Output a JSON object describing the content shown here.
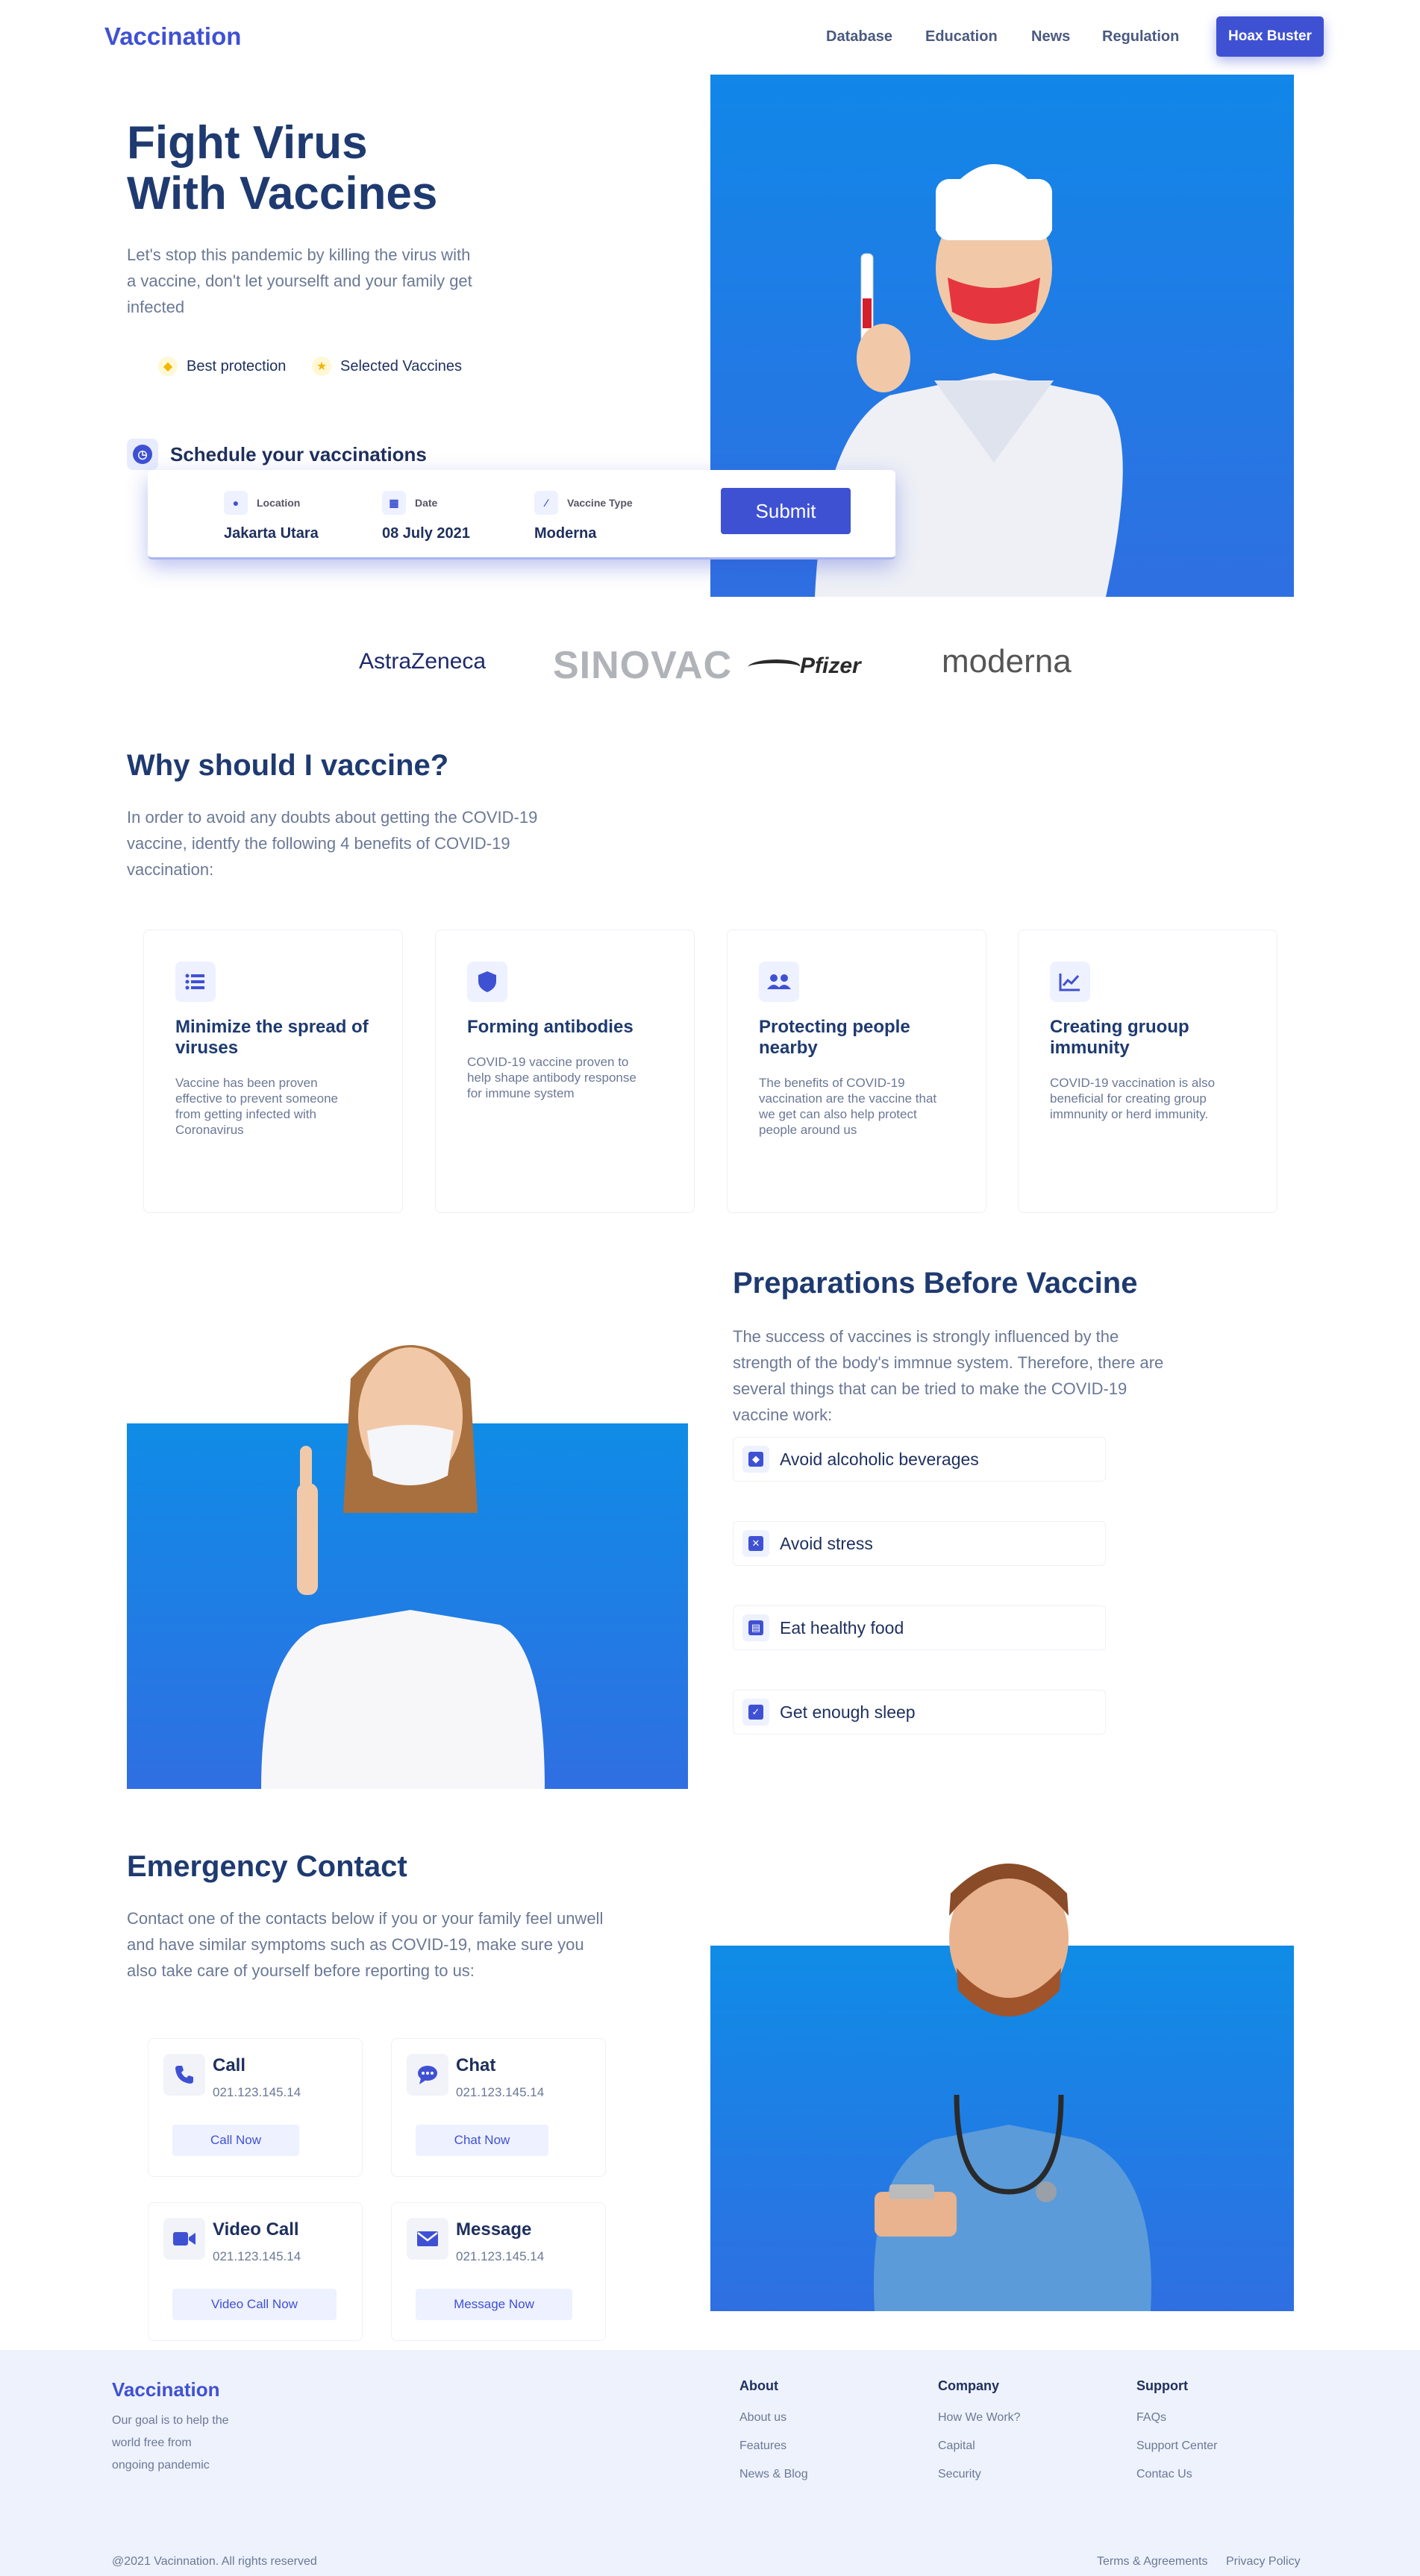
{
  "nav": {
    "logo": "Vaccination",
    "links": [
      "Database",
      "Education",
      "News",
      "Regulation"
    ],
    "cta": "Hoax Buster"
  },
  "hero": {
    "title_line1": "Fight Virus",
    "title_line2": "With Vaccines",
    "subtitle": "Let's stop this pandemic by killing the virus with a vaccine, don't let yourselft and your family get infected",
    "features": [
      "Best protection",
      "Selected Vaccines"
    ],
    "schedule_label": "Schedule your vaccinations",
    "form": {
      "location_label": "Location",
      "location_value": "Jakarta Utara",
      "date_label": "Date",
      "date_value": "08 July 2021",
      "vaccine_label": "Vaccine Type",
      "vaccine_value": "Moderna",
      "submit": "Submit"
    }
  },
  "partners": [
    "AstraZeneca",
    "SINOVAC",
    "Pfizer",
    "moderna"
  ],
  "why": {
    "title": "Why should I vaccine?",
    "text": "In order to avoid any doubts about getting the COVID-19 vaccine, identfy the following 4 benefits of COVID-19 vaccination:",
    "cards": [
      {
        "icon": "list-icon",
        "title": "Minimize the spread of viruses",
        "desc": "Vaccine has been proven effective to prevent someone from getting infected with Coronavirus"
      },
      {
        "icon": "shield-icon",
        "title": "Forming antibodies",
        "desc": "COVID-19 vaccine proven to help shape antibody response for immune system"
      },
      {
        "icon": "people-icon",
        "title": "Protecting people nearby",
        "desc": "The benefits of COVID-19 vaccination are the vaccine that we get can also help protect people around us"
      },
      {
        "icon": "chart-line-icon",
        "title": "Creating gruoup immunity",
        "desc": "COVID-19 vaccination is also beneficial for creating group immnunity or herd immunity."
      }
    ]
  },
  "prep": {
    "title": "Preparations Before Vaccine",
    "text": "The success of vaccines is strongly influenced by the strength of the body's immnue system. Therefore, there are several things that can be tried to make the COVID-19 vaccine work:",
    "items": [
      "Avoid alcoholic beverages",
      "Avoid stress",
      "Eat healthy food",
      "Get enough sleep"
    ]
  },
  "emergency": {
    "title": "Emergency Contact",
    "text": "Contact one of the contacts below if you or your family feel unwell and have similar symptoms such as COVID-19, make sure you also take care of yourself before reporting to us:",
    "contacts": [
      {
        "icon": "phone-icon",
        "title": "Call",
        "number": "021.123.145.14",
        "button": "Call Now"
      },
      {
        "icon": "chat-icon",
        "title": "Chat",
        "number": "021.123.145.14",
        "button": "Chat Now"
      },
      {
        "icon": "video-icon",
        "title": "Video Call",
        "number": "021.123.145.14",
        "button": "Video Call Now"
      },
      {
        "icon": "mail-icon",
        "title": "Message",
        "number": "021.123.145.14",
        "button": "Message Now"
      }
    ]
  },
  "footer": {
    "logo": "Vaccination",
    "goal": "Our goal is to help the world free from ongoing pandemic",
    "columns": [
      {
        "title": "About",
        "links": [
          "About us",
          "Features",
          "News & Blog"
        ]
      },
      {
        "title": "Company",
        "links": [
          "How We Work?",
          "Capital",
          "Security"
        ]
      },
      {
        "title": "Support",
        "links": [
          "FAQs",
          "Support Center",
          "Contac Us"
        ]
      }
    ],
    "copyright": "@2021 Vacinnation. All rights reserved",
    "terms": "Terms & Agreements",
    "privacy": "Privacy Policy"
  },
  "colors": {
    "accent": "#3f51d3",
    "heading": "#1e3a70",
    "text": "#6b7895",
    "image_bg": "#1187e8"
  }
}
